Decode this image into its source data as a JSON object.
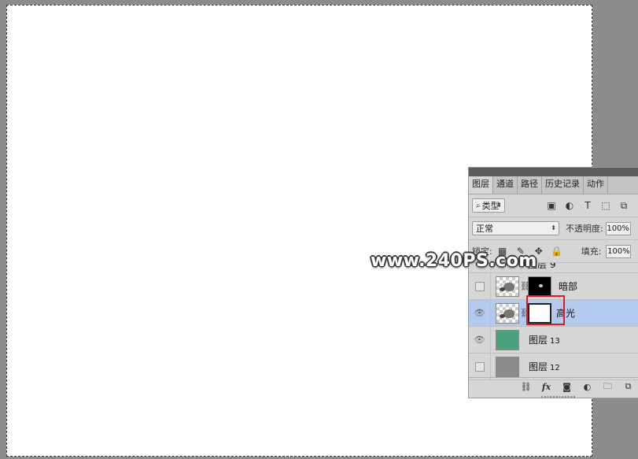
{
  "watermark": "www.240PS.com",
  "panel": {
    "tabs": [
      {
        "label": "图层",
        "active": true
      },
      {
        "label": "通道",
        "active": false
      },
      {
        "label": "路径",
        "active": false
      },
      {
        "label": "历史记录",
        "active": false
      },
      {
        "label": "动作",
        "active": false
      }
    ],
    "filter": {
      "search_icon": "⌕",
      "value": "类型"
    },
    "blend_mode": "正常",
    "opacity_label": "不透明度:",
    "opacity_value": "100%",
    "lock_label": "锁定:",
    "fill_label": "填充:",
    "fill_value": "100%"
  },
  "layers": [
    {
      "name": "图层 9",
      "visible": false,
      "partial": true
    },
    {
      "name": "暗部",
      "visible": false,
      "thumb": "checker",
      "mask": "black"
    },
    {
      "name": "高光",
      "visible": true,
      "thumb": "checker",
      "mask": "white",
      "selected": true
    },
    {
      "name": "图层",
      "num": "13",
      "visible": true,
      "thumb_color": "#4aa27c"
    },
    {
      "name": "图层",
      "num": "12",
      "visible": false,
      "thumb_color": "#8c8c8c"
    }
  ],
  "colors": {
    "selected_row": "#b4c9ef",
    "highlight": "#e01a22"
  }
}
